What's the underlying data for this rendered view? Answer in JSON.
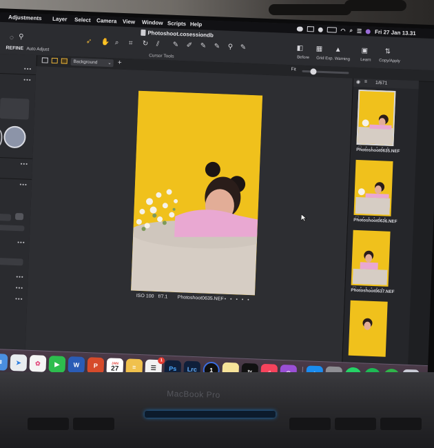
{
  "menubar": {
    "items": [
      "Adjustments",
      "Layer",
      "Select",
      "Camera",
      "View",
      "Window",
      "Scripts",
      "Help"
    ],
    "clock": "Fri 27 Jan  13.31"
  },
  "toolbar": {
    "doc_title": "Photoshoot.cosessiondb",
    "cursor_tools_label": "Cursor Tools",
    "refine_label": "REFINE",
    "auto_adjust_label": "Auto Adjust",
    "before_label": "Before",
    "grid_label": "Grid",
    "exp_warning_label": "Exp. Warning",
    "learn_label": "Learn",
    "copy_apply_label": "Copy/Apply"
  },
  "subbar": {
    "layer_value": "Background",
    "fit_label": "Fit",
    "zoom_level": 0.2
  },
  "viewer": {
    "iso": "ISO 100",
    "aperture": "f/7.1",
    "filename": "Photoshoot0635.NEF",
    "rating_dots": "• • • • •"
  },
  "filmstrip": {
    "count": "1/671",
    "thumbs": [
      {
        "name": "Photoshoot0635.NEF",
        "selected": true
      },
      {
        "name": "Photoshoot0636.NEF",
        "selected": false
      },
      {
        "name": "Photoshoot0637.NEF",
        "selected": false
      }
    ]
  },
  "dock": {
    "calendar_month": "JAN",
    "calendar_day": "27",
    "reminders_badge": "1",
    "ps_label": "Ps",
    "lrc_label": "Lrc",
    "one_label": "1",
    "tv_label": "tv"
  },
  "laptop": {
    "brand": "MacBook Pro"
  },
  "colors": {
    "photo_background": "#f0c11c",
    "accent": "#e8b33a",
    "app_background": "#2d2e32"
  }
}
